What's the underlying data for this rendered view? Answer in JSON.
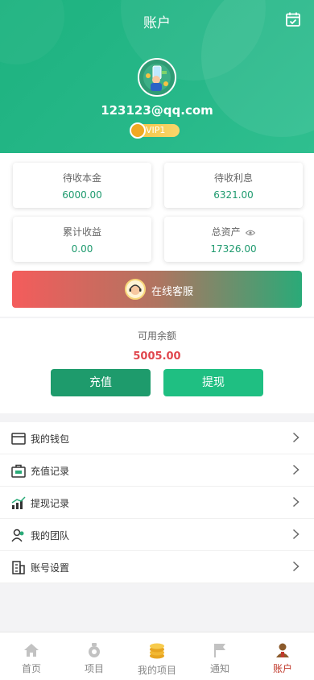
{
  "header": {
    "title": "账户",
    "email": "123123@qq.com",
    "vip": "VIP1"
  },
  "stats": {
    "pending_principal": {
      "label": "待收本金",
      "value": "6000.00"
    },
    "pending_interest": {
      "label": "待收利息",
      "value": "6321.00"
    },
    "cumulative_income": {
      "label": "累计收益",
      "value": "0.00"
    },
    "total_assets": {
      "label": "总资产",
      "value": "17326.00"
    }
  },
  "service": {
    "label": "在线客服"
  },
  "balance": {
    "label": "可用余额",
    "amount": "5005.00",
    "recharge": "充值",
    "withdraw": "提现"
  },
  "menu": [
    {
      "label": "我的钱包",
      "icon": "wallet-icon"
    },
    {
      "label": "充值记录",
      "icon": "recharge-record-icon"
    },
    {
      "label": "提现记录",
      "icon": "withdraw-record-icon"
    },
    {
      "label": "我的团队",
      "icon": "team-icon"
    },
    {
      "label": "账号设置",
      "icon": "settings-building-icon"
    }
  ],
  "tabs": [
    {
      "label": "首页",
      "icon": "home-icon"
    },
    {
      "label": "项目",
      "icon": "project-icon"
    },
    {
      "label": "我的项目",
      "icon": "coins-icon"
    },
    {
      "label": "通知",
      "icon": "flag-icon"
    },
    {
      "label": "账户",
      "icon": "user-icon"
    }
  ],
  "colors": {
    "primary": "#1db27f",
    "accent_red": "#e0464d",
    "active_tab": "#c0392b"
  }
}
